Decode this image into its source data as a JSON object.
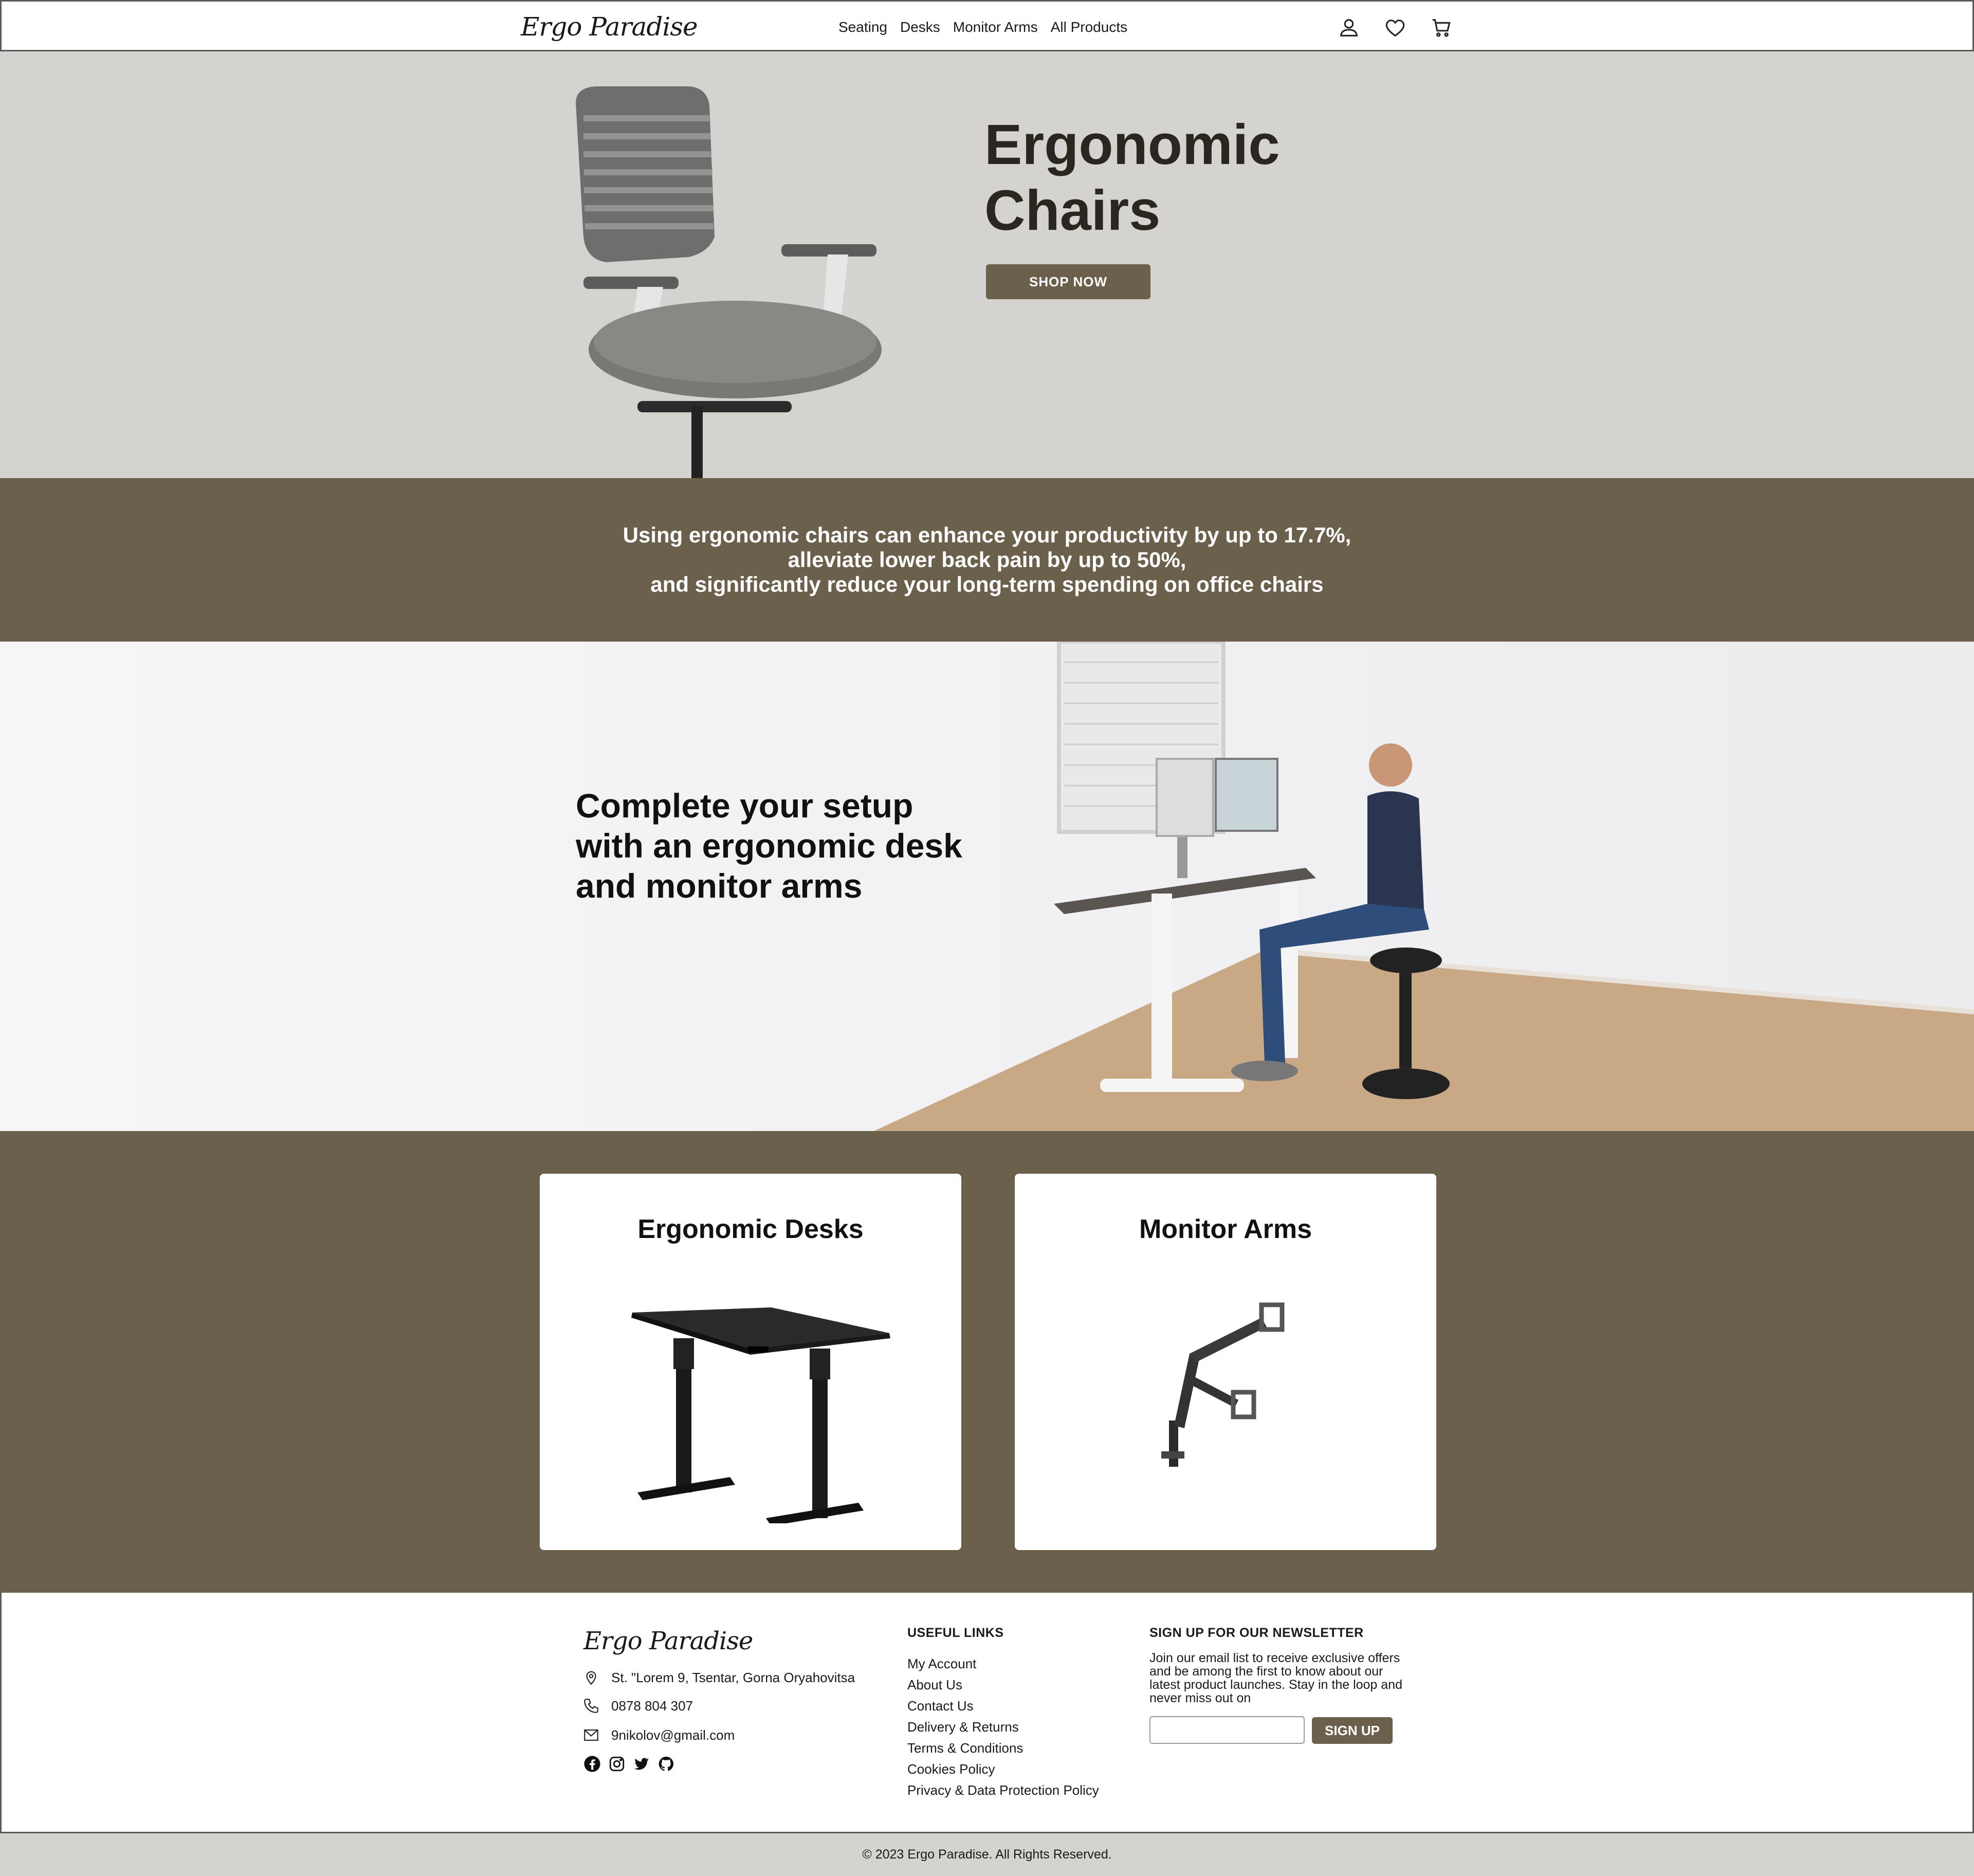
{
  "brand": {
    "name": "Ergo Paradise"
  },
  "nav": {
    "links": [
      "Seating",
      "Desks",
      "Monitor Arms",
      "All Products"
    ],
    "icons": [
      "user-icon",
      "heart-icon",
      "cart-icon"
    ]
  },
  "hero": {
    "title_line1": "Ergonomic",
    "title_line2": "Chairs",
    "button": "SHOP NOW"
  },
  "stats": {
    "line1": "Using ergonomic chairs can enhance your productivity by up to 17.7%,",
    "line2": "alleviate lower back pain by up to 50%,",
    "line3": "and significantly reduce your long-term spending on office chairs"
  },
  "setup": {
    "line1": "Complete your setup",
    "line2": "with an ergonomic desk",
    "line3": "and monitor arms"
  },
  "categories": [
    {
      "title": "Ergonomic Desks"
    },
    {
      "title": "Monitor Arms"
    }
  ],
  "footer": {
    "address": "St. \"Lorem 9, Tsentar, Gorna Oryahovitsa",
    "phone": "0878 804 307",
    "email": "9nikolov@gmail.com",
    "socials": [
      "facebook-icon",
      "instagram-icon",
      "twitter-icon",
      "github-icon"
    ],
    "links_heading": "USEFUL LINKS",
    "links": [
      "My Account",
      "About Us",
      "Contact Us",
      "Delivery & Returns",
      "Terms & Conditions",
      "Cookies Policy",
      "Privacy & Data Protection Policy"
    ],
    "newsletter_heading": "SIGN UP FOR OUR NEWSLETTER",
    "newsletter_text": "Join our email list to receive exclusive offers and be among the first to know about our latest product launches. Stay in the loop and never miss out on",
    "newsletter_input_value": "",
    "newsletter_button": "SIGN UP"
  },
  "copyright": "© 2023 Ergo Paradise. All Rights Reserved.",
  "colors": {
    "accent": "#6b604b",
    "hero_bg": "#d4d3cf",
    "text_dark": "#2a2620"
  }
}
